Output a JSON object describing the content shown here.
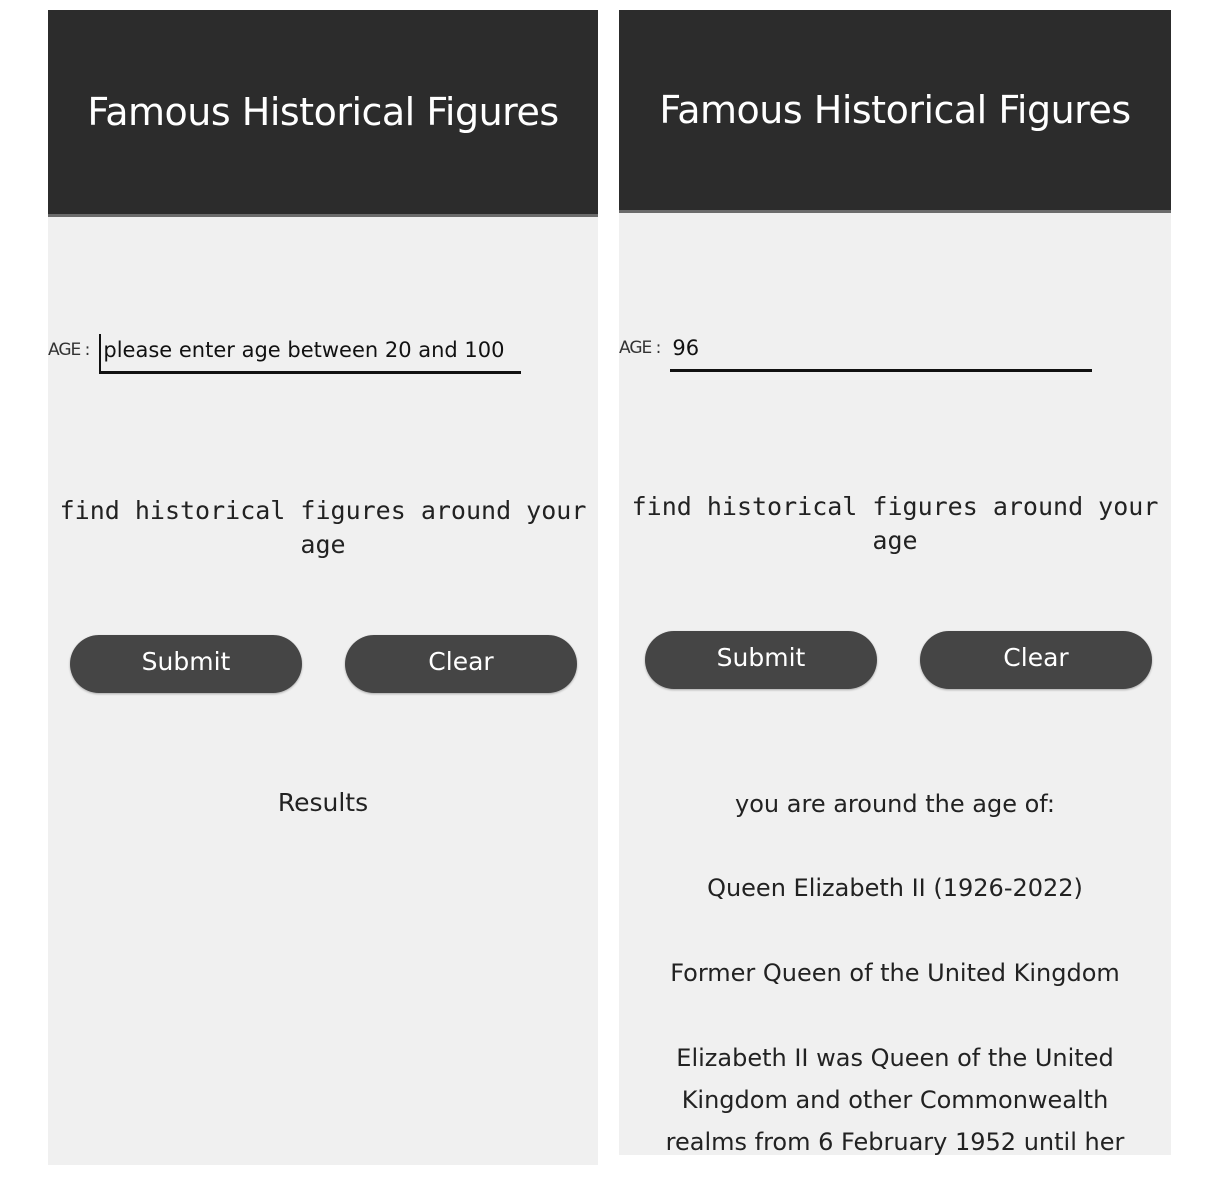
{
  "app": {
    "title": "Famous Historical Figures"
  },
  "left_screen": {
    "age_label": "AGE :",
    "age_input": {
      "value": "",
      "placeholder": "please enter age between 20 and 100"
    },
    "tagline": "find historical figures around your age",
    "submit_label": "Submit",
    "clear_label": "Clear",
    "results_label": "Results"
  },
  "right_screen": {
    "age_label": "AGE :",
    "age_input": {
      "value": "96",
      "placeholder": ""
    },
    "tagline": "find historical figures around your age",
    "submit_label": "Submit",
    "clear_label": "Clear",
    "result_intro": "you are around the age of:",
    "figure_name": "Queen Elizabeth II (1926-2022)",
    "figure_title": "Former Queen of the United Kingdom",
    "figure_description": "Elizabeth II was Queen of the United Kingdom and other Commonwealth realms from 6 February 1952 until her"
  },
  "colors": {
    "header_bg": "#2c2c2c",
    "screen_bg": "#f0f0f0",
    "button_bg": "#454545"
  }
}
